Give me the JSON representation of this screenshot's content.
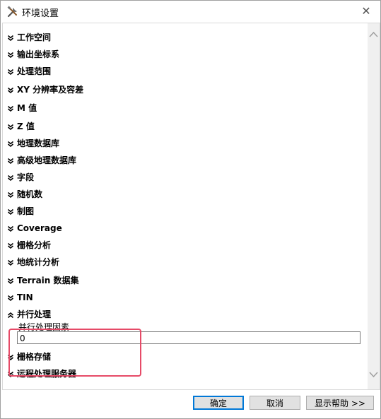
{
  "window": {
    "title": "环境设置",
    "close_glyph": "✕"
  },
  "sections": [
    {
      "label": "工作空间",
      "expanded": false
    },
    {
      "label": "输出坐标系",
      "expanded": false
    },
    {
      "label": "处理范围",
      "expanded": false
    },
    {
      "label": "XY 分辨率及容差",
      "expanded": false
    },
    {
      "label": "M 值",
      "expanded": false
    },
    {
      "label": "Z 值",
      "expanded": false
    },
    {
      "label": "地理数据库",
      "expanded": false
    },
    {
      "label": "高级地理数据库",
      "expanded": false
    },
    {
      "label": "字段",
      "expanded": false
    },
    {
      "label": "随机数",
      "expanded": false
    },
    {
      "label": "制图",
      "expanded": false
    },
    {
      "label": "Coverage",
      "expanded": false
    },
    {
      "label": "栅格分析",
      "expanded": false
    },
    {
      "label": "地统计分析",
      "expanded": false
    },
    {
      "label": "Terrain 数据集",
      "expanded": false
    },
    {
      "label": "TIN",
      "expanded": false
    },
    {
      "label": "并行处理",
      "expanded": true
    },
    {
      "label": "栅格存储",
      "expanded": false
    },
    {
      "label": "远程处理服务器",
      "expanded": false
    }
  ],
  "parallel": {
    "factor_label": "并行处理因素",
    "factor_value": "0"
  },
  "buttons": {
    "ok": "确定",
    "cancel": "取消",
    "help": "显示帮助 >>"
  },
  "colors": {
    "highlight": "#e64a67",
    "default_button_border": "#0078d7"
  }
}
